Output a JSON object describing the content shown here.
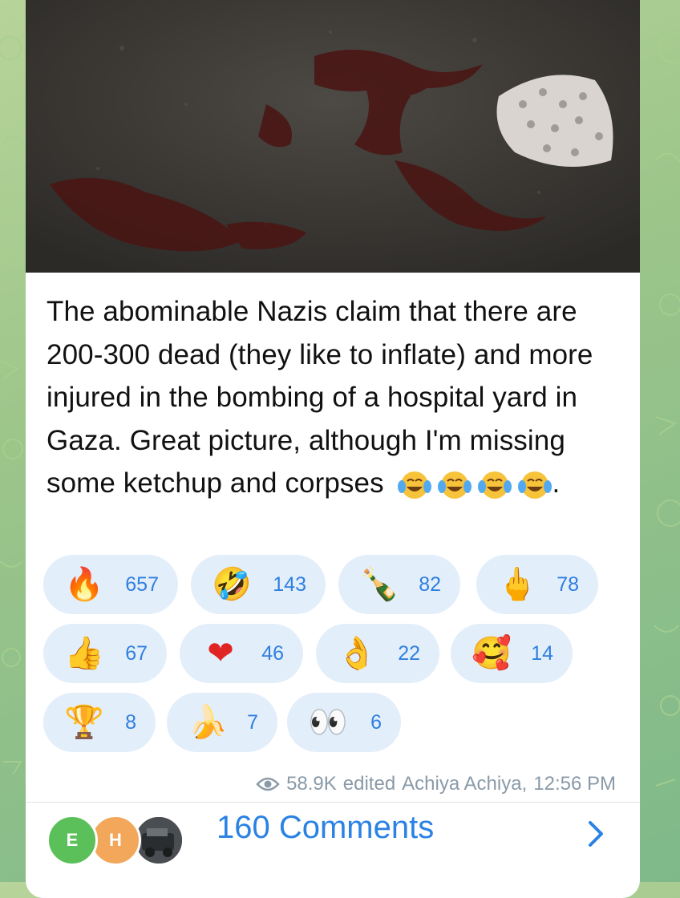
{
  "post": {
    "caption": "The abominable Nazis claim that there are 200-300 dead (they like to inflate) and more injured in the bombing of a hospital yard in Gaza. Great picture, although I'm missing some ketchup and corpses",
    "caption_tail": ".",
    "caption_emojis": [
      "face-with-tears-of-joy",
      "face-with-tears-of-joy",
      "face-with-tears-of-joy",
      "face-with-tears-of-joy"
    ]
  },
  "reactions": [
    {
      "emoji": "🔥",
      "icon": "fire-icon",
      "count": "657"
    },
    {
      "emoji": "🤣",
      "icon": "rolling-laughing-icon",
      "count": "143"
    },
    {
      "emoji": "🍾",
      "icon": "champagne-bottle-icon",
      "count": "82"
    },
    {
      "emoji": "🖕",
      "icon": "middle-finger-icon",
      "count": "78"
    },
    {
      "emoji": "👍",
      "icon": "thumbs-up-icon",
      "count": "67"
    },
    {
      "emoji": "❤",
      "icon": "heart-icon",
      "count": "46"
    },
    {
      "emoji": "👌",
      "icon": "ok-hand-icon",
      "count": "22"
    },
    {
      "emoji": "🥰",
      "icon": "smiling-hearts-icon",
      "count": "14"
    },
    {
      "emoji": "🏆",
      "icon": "trophy-icon",
      "count": "8"
    },
    {
      "emoji": "🍌",
      "icon": "banana-icon",
      "count": "7"
    },
    {
      "emoji": "👀",
      "icon": "eyes-icon",
      "count": "6"
    }
  ],
  "meta": {
    "views": "58.9K",
    "status": "edited",
    "author": "Achiya Achiya",
    "time": "12:56 PM"
  },
  "comments": {
    "avatars": [
      {
        "initial": "E",
        "color": "#5cc05a"
      },
      {
        "initial": "H",
        "color": "#f2a75a"
      }
    ],
    "label": "160 Comments"
  },
  "colors": {
    "accent": "#2a82e4",
    "reaction_bg": "#e3eefb"
  }
}
